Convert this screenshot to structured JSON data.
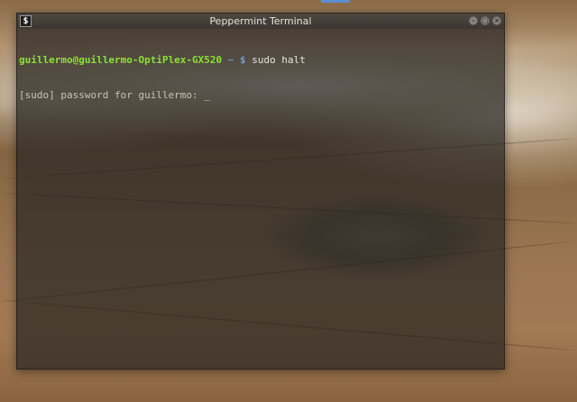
{
  "window": {
    "title": "Peppermint Terminal",
    "icon_glyph": "$"
  },
  "terminal": {
    "lines": [
      {
        "user_host": "guillermo@guillermo-OptiPlex-GX520",
        "separator": " ~ $ ",
        "command": "sudo halt"
      },
      {
        "text": "[sudo] password for guillermo: ",
        "cursor": "_"
      }
    ],
    "colors": {
      "user_host": "#8ae234",
      "path": "#729fcf",
      "text": "#d9d4cb"
    }
  },
  "icons": {
    "app": "terminal-icon",
    "minimize": "minimize-icon",
    "maximize": "maximize-icon",
    "close": "close-icon"
  }
}
